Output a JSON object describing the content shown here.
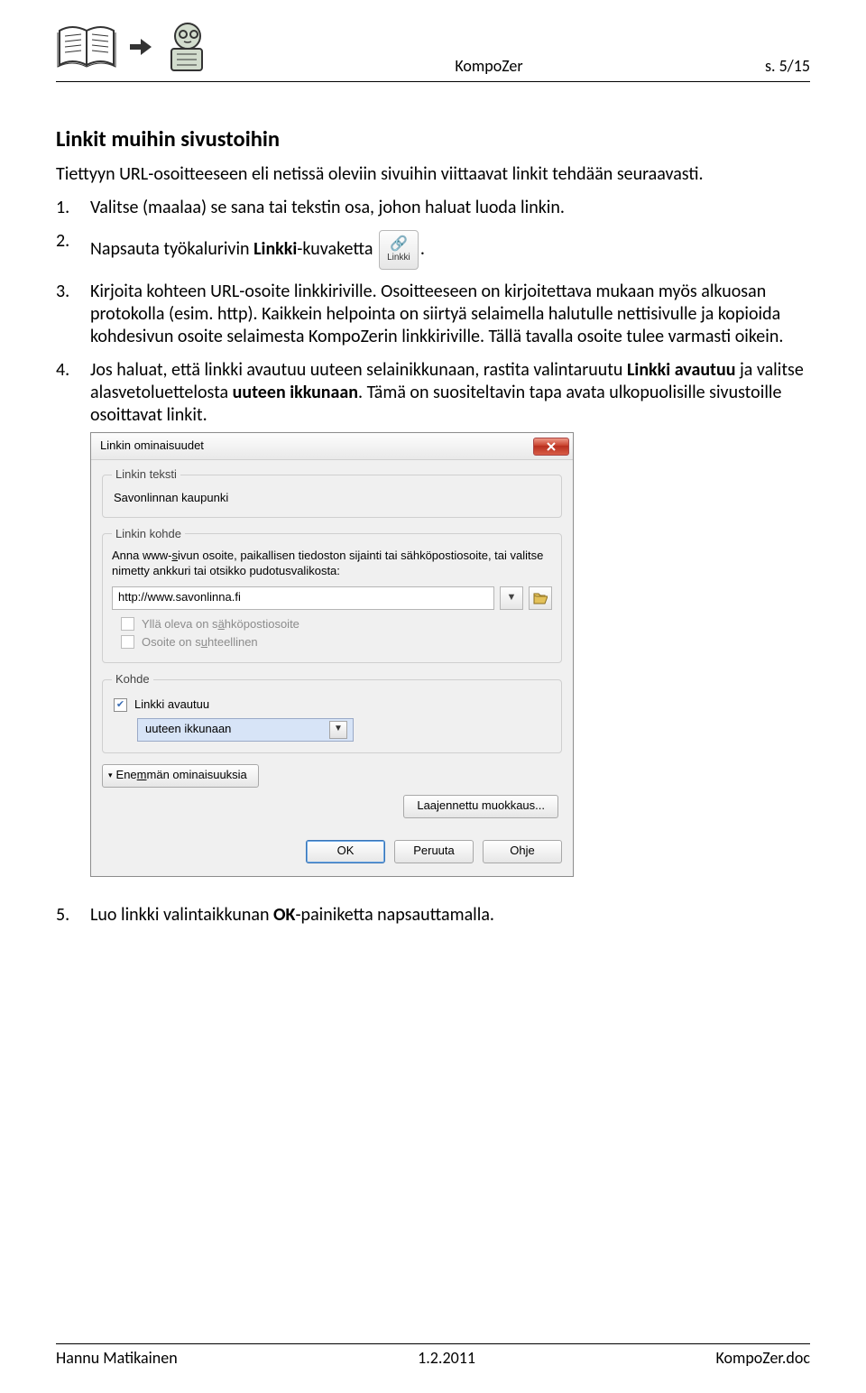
{
  "header": {
    "title": "KompoZer",
    "page_label": "s. 5/15"
  },
  "content": {
    "heading": "Linkit muihin sivustoihin",
    "intro": "Tiettyyn URL-osoitteeseen eli netissä oleviin sivuihin viittaavat linkit tehdään seuraavasti.",
    "steps": {
      "s1": {
        "num": "1.",
        "text": "Valitse (maalaa) se sana tai tekstin osa, johon haluat luoda linkin."
      },
      "s2": {
        "num": "2.",
        "pre": "Napsauta työkalurivin ",
        "bold": "Linkki",
        "mid": "-kuvaketta ",
        "btn_label": "Linkki",
        "post": "."
      },
      "s3": {
        "num": "3.",
        "text": "Kirjoita kohteen URL-osoite linkkiriville. Osoitteeseen on kirjoitettava mukaan myös alkuosan protokolla (esim. http). Kaikkein helpointa on siirtyä selaimella halutulle nettisivulle ja kopioida kohdesivun osoite selaimesta KompoZerin linkkiriville. Tällä tavalla osoite tulee varmasti oikein."
      },
      "s4": {
        "num": "4.",
        "pre": "Jos haluat, että linkki avautuu uuteen selainikkunaan, rastita valintaruutu ",
        "b1": "Linkki avautuu",
        "mid1": " ja valitse alasvetoluettelosta ",
        "b2": "uuteen ikkunaan",
        "mid2": ". Tämä on suositeltavin tapa avata ulkopuolisille sivustoille osoittavat linkit."
      },
      "s5": {
        "num": "5.",
        "pre": "Luo linkki valintaikkunan ",
        "b": "OK",
        "post": "-painiketta napsauttamalla."
      }
    }
  },
  "dialog": {
    "title": "Linkin ominaisuudet",
    "group_text": {
      "legend": "Linkin teksti",
      "value": "Savonlinnan kaupunki"
    },
    "group_target": {
      "legend": "Linkin kohde",
      "instructions_a": "Anna www-",
      "instructions_b": "ivun osoite, paikallisen tiedoston sijainti tai sähköpostiosoite, tai valitse nimetty ankkuri tai otsikko pudotusvalikosta:",
      "url": "http://www.savonlinna.fi",
      "chk_email_a": "Yllä oleva on s",
      "chk_email_b": "hköpostiosoite",
      "chk_rel_a": "Osoite on s",
      "chk_rel_b": "hteellinen"
    },
    "group_kohde": {
      "legend": "Kohde",
      "chk_open": "Linkki avautuu",
      "select_value": "uuteen ikkunaan"
    },
    "more_a": "Ene",
    "more_b": "män ominaisuuksia",
    "advanced": "Laajennettu muokkaus...",
    "ok": "OK",
    "cancel": "Peruuta",
    "help": "Ohje"
  },
  "footer": {
    "left": "Hannu Matikainen",
    "center": "1.2.2011",
    "right": "KompoZer.doc"
  }
}
